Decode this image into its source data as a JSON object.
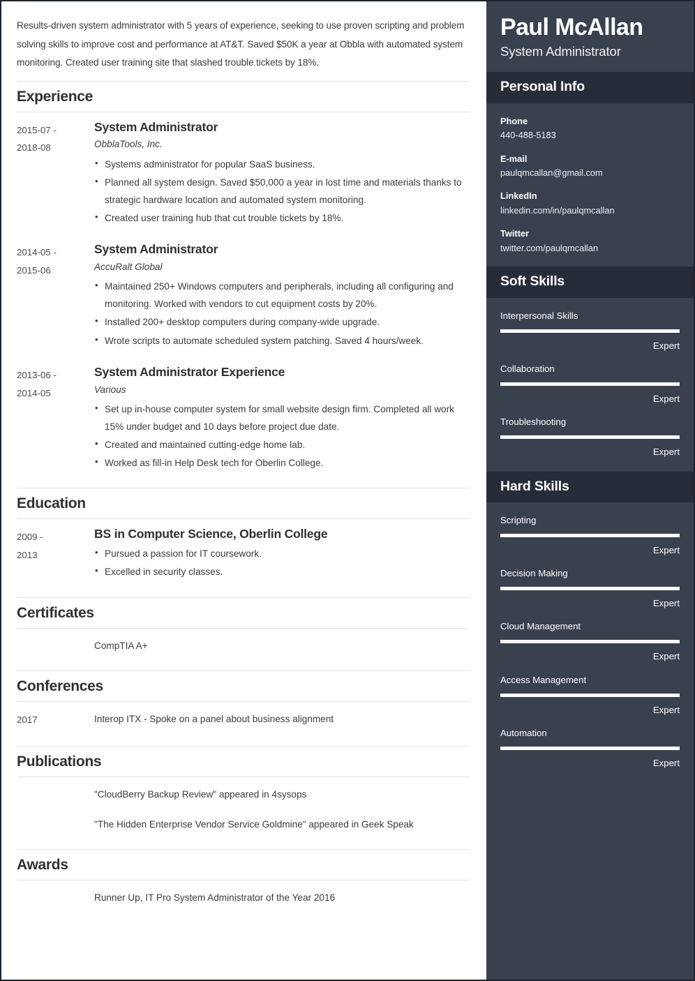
{
  "colors": {
    "sidebar_bg": "#39414f",
    "sidebar_header_bg": "#272d38",
    "page_bg": "#ffffff",
    "body_text": "#3b3b3b",
    "heading_text": "#2f3033",
    "rule": "#e3e3e3",
    "bar_fill": "#ffffff"
  },
  "main": {
    "summary": "Results-driven system administrator with 5 years of experience, seeking to use proven scripting and problem solving skills to improve cost and performance at AT&T. Saved $50K a year at Obbla with automated system monitoring. Created user training site that slashed trouble tickets by 18%.",
    "sections": {
      "experience": {
        "title": "Experience",
        "entries": [
          {
            "dates": "2015-07 - 2018-08",
            "date_line_1": "2015-07 -",
            "date_line_2": "2018-08",
            "title": "System Administrator",
            "company": "ObblaTools, Inc.",
            "bullets": [
              "Systems administrator for popular SaaS business.",
              "Planned all system design. Saved $50,000 a year in lost time and materials thanks to strategic hardware location and automated system monitoring.",
              "Created user training hub that cut trouble tickets by 18%."
            ]
          },
          {
            "dates": "2014-05 - 2015-06",
            "date_line_1": "2014-05 -",
            "date_line_2": "2015-06",
            "title": "System Administrator",
            "company": "AccuRalt Global",
            "bullets": [
              "Maintained 250+ Windows computers and peripherals, including all configuring and monitoring. Worked with vendors to cut equipment costs by 20%.",
              "Installed 200+ desktop computers during company-wide upgrade.",
              "Wrote scripts to automate scheduled system patching. Saved 4 hours/week."
            ]
          },
          {
            "dates": "2013-06 - 2014-05",
            "date_line_1": "2013-06 -",
            "date_line_2": "2014-05",
            "title": "System Administrator Experience",
            "company": "Various",
            "bullets": [
              "Set up in-house computer system for small website design firm. Completed all work 15% under budget and 10 days before project due date.",
              "Created and maintained cutting-edge home lab.",
              "Worked as fill-in Help Desk tech for Oberlin College."
            ]
          }
        ]
      },
      "education": {
        "title": "Education",
        "entries": [
          {
            "dates": "2009 - 2013",
            "date_line_1": "2009 -",
            "date_line_2": "2013",
            "title": "BS in Computer Science, Oberlin College",
            "bullets": [
              "Pursued a passion for IT coursework.",
              "Excelled in security classes."
            ]
          }
        ]
      },
      "certificates": {
        "title": "Certificates",
        "entries": [
          {
            "dates": "",
            "text": "CompTIA A+"
          }
        ]
      },
      "conferences": {
        "title": "Conferences",
        "entries": [
          {
            "dates": "2017",
            "text": "Interop ITX - Spoke on a panel about business alignment"
          }
        ]
      },
      "publications": {
        "title": "Publications",
        "dates": "",
        "entries": [
          {
            "text": "\"CloudBerry Backup Review\" appeared in 4sysops"
          },
          {
            "text": "\"The Hidden Enterprise Vendor Service Goldmine\" appeared in Geek Speak"
          }
        ]
      },
      "awards": {
        "title": "Awards",
        "entries": [
          {
            "dates": "",
            "text": "Runner Up, IT Pro System Administrator of the Year 2016"
          }
        ]
      }
    }
  },
  "sidebar": {
    "name": "Paul McAllan",
    "role": "System Administrator",
    "personal_info": {
      "title": "Personal Info",
      "items": [
        {
          "label": "Phone",
          "value": "440-488-5183"
        },
        {
          "label": "E-mail",
          "value": "paulqmcallan@gmail.com"
        },
        {
          "label": "LinkedIn",
          "value": "linkedin.com/in/paulqmcallan"
        },
        {
          "label": "Twitter",
          "value": "twitter.com/paulqmcallan"
        }
      ]
    },
    "soft_skills": {
      "title": "Soft Skills",
      "items": [
        {
          "name": "Interpersonal Skills",
          "level": "Expert",
          "percent": 100
        },
        {
          "name": "Collaboration",
          "level": "Expert",
          "percent": 100
        },
        {
          "name": "Troubleshooting",
          "level": "Expert",
          "percent": 100
        }
      ]
    },
    "hard_skills": {
      "title": "Hard Skills",
      "items": [
        {
          "name": "Scripting",
          "level": "Expert",
          "percent": 100
        },
        {
          "name": "Decision Making",
          "level": "Expert",
          "percent": 100
        },
        {
          "name": "Cloud Management",
          "level": "Expert",
          "percent": 100
        },
        {
          "name": "Access Management",
          "level": "Expert",
          "percent": 100
        },
        {
          "name": "Automation",
          "level": "Expert",
          "percent": 100
        }
      ]
    }
  }
}
